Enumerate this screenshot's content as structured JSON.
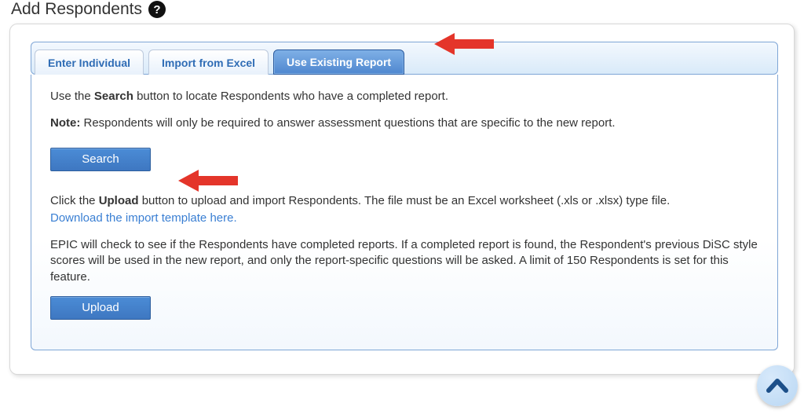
{
  "header": {
    "title": "Add Respondents"
  },
  "tabs": {
    "enter_individual": "Enter Individual",
    "import_excel": "Import from Excel",
    "use_existing": "Use Existing Report"
  },
  "content": {
    "search_instruction_prefix": "Use the ",
    "search_instruction_bold": "Search",
    "search_instruction_suffix": " button to locate Respondents who have a completed report.",
    "note_label": "Note:",
    "note_text": " Respondents will only be required to answer assessment questions that are specific to the new report.",
    "search_button": "Search",
    "upload_instruction_prefix": "Click the ",
    "upload_instruction_bold": "Upload",
    "upload_instruction_suffix": " button to upload and import Respondents. The file must be an Excel worksheet (.xls or .xlsx) type file.",
    "download_link": "Download the import template here.",
    "epic_text": "EPIC will check to see if the Respondents have completed reports. If a completed report is found, the Respondent's previous DiSC style scores will be used in the new report, and only the report-specific questions will be asked. A limit of 150 Respondents is set for this feature.",
    "upload_button": "Upload"
  },
  "colors": {
    "arrow": "#e4352a",
    "tab_active_bg": "#4f87cf",
    "link": "#3a7fd3",
    "chevron": "#1c4f89"
  }
}
